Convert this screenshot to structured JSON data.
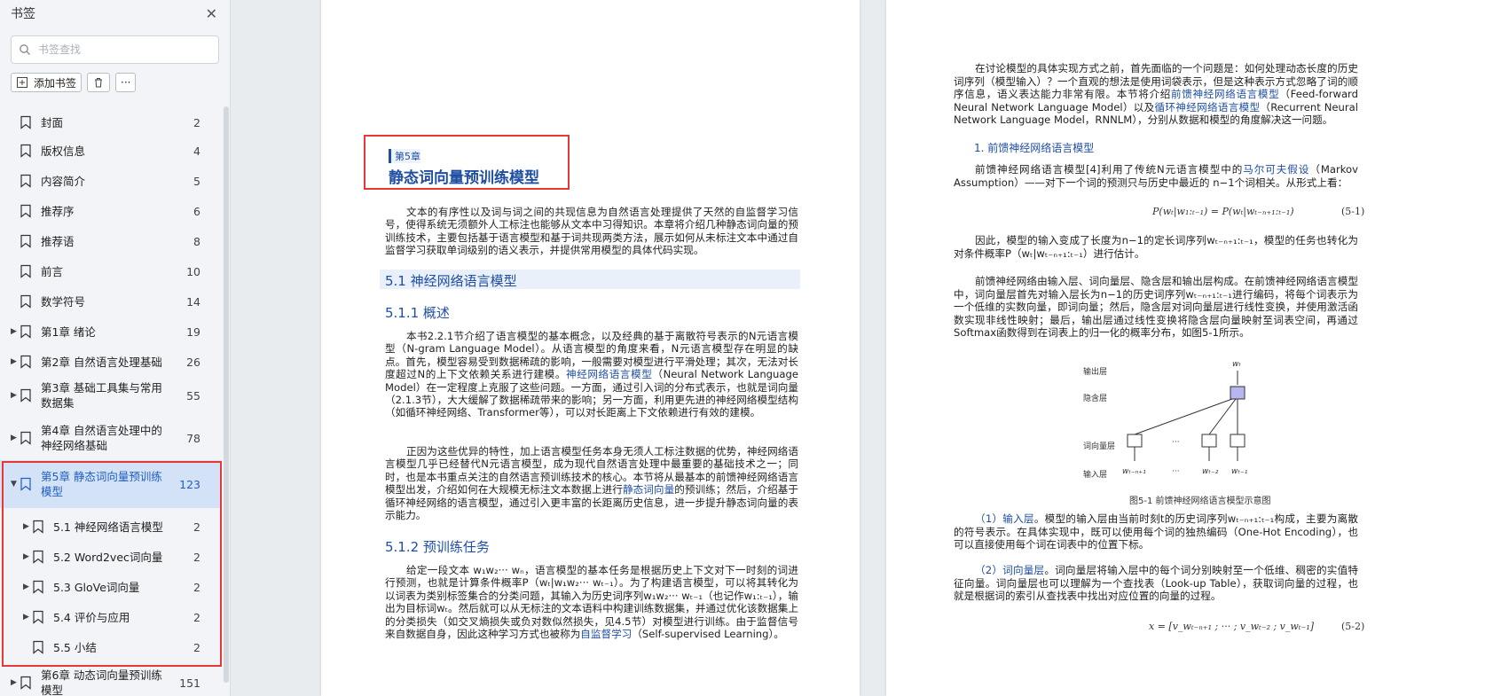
{
  "sidebar": {
    "title": "书签",
    "search_placeholder": "书签查找",
    "add_bookmark_label": "添加书签",
    "more_label": "···",
    "items": [
      {
        "title": "封面",
        "page": "2",
        "expandable": false,
        "level": 0
      },
      {
        "title": "版权信息",
        "page": "4",
        "expandable": false,
        "level": 0
      },
      {
        "title": "内容简介",
        "page": "5",
        "expandable": false,
        "level": 0
      },
      {
        "title": "推荐序",
        "page": "6",
        "expandable": false,
        "level": 0
      },
      {
        "title": "推荐语",
        "page": "8",
        "expandable": false,
        "level": 0
      },
      {
        "title": "前言",
        "page": "10",
        "expandable": false,
        "level": 0
      },
      {
        "title": "数学符号",
        "page": "14",
        "expandable": false,
        "level": 0
      },
      {
        "title": "第1章 绪论",
        "page": "19",
        "expandable": true,
        "level": 0
      },
      {
        "title": "第2章 自然语言处理基础",
        "page": "26",
        "expandable": true,
        "level": 0
      },
      {
        "title": "第3章 基础工具集与常用数据集",
        "page": "55",
        "expandable": true,
        "level": 0
      },
      {
        "title": "第4章 自然语言处理中的神经网络基础",
        "page": "78",
        "expandable": true,
        "level": 0
      },
      {
        "title": "第5章 静态词向量预训练模型",
        "page": "123",
        "expandable": true,
        "expanded": true,
        "selected": true,
        "level": 0
      },
      {
        "title": "5.1 神经网络语言模型",
        "page": "2",
        "expandable": true,
        "level": 1
      },
      {
        "title": "5.2 Word2vec词向量",
        "page": "2",
        "expandable": true,
        "level": 1
      },
      {
        "title": "5.3 GloVe词向量",
        "page": "2",
        "expandable": true,
        "level": 1
      },
      {
        "title": "5.4 评价与应用",
        "page": "2",
        "expandable": true,
        "level": 1
      },
      {
        "title": "5.5 小结",
        "page": "2",
        "expandable": false,
        "level": 1
      },
      {
        "title": "第6章 动态词向量预训练模型",
        "page": "151",
        "expandable": true,
        "level": 0
      }
    ]
  },
  "left_page": {
    "chapter_tag": "第5章",
    "chapter_title": "静态词向量预训练模型",
    "intro": "文本的有序性以及词与词之间的共现信息为自然语言处理提供了天然的自监督学习信号，使得系统无须额外人工标注也能够从文本中习得知识。本章将介绍几种静态词向量的预训练技术，主要包括基于语言模型和基于词共现两类方法，展示如何从未标注文本中通过自监督学习获取单词级别的语义表示，并提供常用模型的具体代码实现。",
    "h_5_1": "5.1  神经网络语言模型",
    "h_5_1_1": "5.1.1  概述",
    "p1_a": "本书2.2.1节介绍了语言模型的基本概念，以及经典的基于离散符号表示的N元语言模型（N-gram Language Model）。从语言模型的角度来看，N元语言模型存在明显的缺点。首先，模型容易受到数据稀疏的影响，一般需要对模型进行平滑处理；其次，无法对长度超过N的上下文依赖关系进行建模。",
    "p1_link": "神经网络语言模型",
    "p1_b": "（Neural Network Language Model）在一定程度上克服了这些问题。一方面，通过引入词的分布式表示，也就是词向量（2.1.3节），大大缓解了数据稀疏带来的影响；另一方面，利用更先进的神经网络模型结构（如循环神经网络、Transformer等），可以对长距离上下文依赖进行有效的建模。",
    "p2_a": "正因为这些优异的特性，加上语言模型任务本身无须人工标注数据的优势，神经网络语言模型几乎已经替代N元语言模型，成为现代自然语言处理中最重要的基础技术之一；同时，也是本书重点关注的自然语言预训练技术的核心。本节将从最基本的前馈神经网络语言模型出发，介绍如何在大规模无标注文本数据上进行",
    "p2_link": "静态词向量",
    "p2_b": "的预训练；然后，介绍基于循环神经网络的语言模型，通过引入更丰富的长距离历史信息，进一步提升静态词向量的表示能力。",
    "h_5_1_2": "5.1.2  预训练任务",
    "p3_a": "给定一段文本 w₁w₂··· wₙ，语言模型的基本任务是根据历史上下文对下一时刻的词进行预测，也就是计算条件概率P（wₜ|w₁w₂··· wₜ₋₁）。为了构建语言模型，可以将其转化为以词表为类别标签集合的分类问题，其输入为历史词序列w₁w₂··· wₜ₋₁（也记作w₁:ₜ₋₁），输出为目标词wₜ。然后就可以从无标注的文本语料中构建训练数据集，并通过优化该数据集上的分类损失（如交叉熵损失或负对数似然损失，见4.5节）对模型进行训练。由于监督信号来自数据自身，因此这种学习方式也被称为",
    "p3_link": "自监督学习",
    "p3_b": "（Self-supervised Learning）。"
  },
  "right_page": {
    "p1_a": "在讨论模型的具体实现方式之前，首先面临的一个问题是：如何处理动态长度的历史词序列（模型输入）？一个直观的想法是使用词袋表示，但是这种表示方式忽略了词的顺序信息，语义表达能力非常有限。本节将介绍",
    "p1_link1": "前馈神经网络语言模型",
    "p1_b": "（Feed-forward Neural Network Language Model）以及",
    "p1_link2": "循环神经网络语言模型",
    "p1_c": "（Recurrent Neural Network Language Model，RNNLM），分别从数据和模型的角度解决这一问题。",
    "sub1": "1. 前馈神经网络语言模型",
    "p2_a": "前馈神经网络语言模型[4]利用了传统N元语言模型中的",
    "p2_link": "马尔可夫假设",
    "p2_b": "（Markov Assumption）——对下一个词的预测只与历史中最近的 n−1个词相关。从形式上看：",
    "formula1": "P(wₜ|w₁:ₜ₋₁) = P(wₜ|wₜ₋ₙ₊₁:ₜ₋₁)",
    "eq1": "(5-1)",
    "p3": "因此，模型的输入变成了长度为n−1的定长词序列wₜ₋ₙ₊₁:ₜ₋₁，模型的任务也转化为对条件概率P（wₜ|wₜ₋ₙ₊₁:ₜ₋₁）进行估计。",
    "p4": "前馈神经网络由输入层、词向量层、隐含层和输出层构成。在前馈神经网络语言模型中，词向量层首先对输入层长为n−1的历史词序列wₜ₋ₙ₊₁:ₜ₋₁进行编码，将每个词表示为一个低维的实数向量，即词向量；然后，隐含层对词向量层进行线性变换，并使用激活函数实现非线性映射；最后，输出层通过线性变换将隐含层向量映射至词表空间，再通过Softmax函数得到在词表上的归一化的概率分布，如图5-1所示。",
    "fig": {
      "label_output": "输出层",
      "label_hidden": "隐含层",
      "label_embed": "词向量层",
      "label_input": "输入层",
      "out_word": "wₜ",
      "in1": "wₜ₋ₙ₊₁",
      "in2": "wₜ₋₂",
      "in3": "wₜ₋₁",
      "dots": "···",
      "caption": "图5-1  前馈神经网络语言模型示意图"
    },
    "p5_link": "（1）输入层",
    "p5_b": "。模型的输入层由当前时刻t的历史词序列wₜ₋ₙ₊₁:ₜ₋₁构成，主要为离散的符号表示。在具体实现中，既可以使用每个词的独热编码（One-Hot Encoding），也可以直接使用每个词在词表中的位置下标。",
    "p6_link": "（2）词向量层",
    "p6_b": "。词向量层将输入层中的每个词分别映射至一个低维、稠密的实值特征向量。词向量层也可以理解为一个查找表（Look-up Table），获取词向量的过程，也就是根据词的索引从查找表中找出对应位置的向量的过程。",
    "formula2": "x = [v_wₜ₋ₙ₊₁ ; ··· ; v_wₜ₋₂ ; v_wₜ₋₁]",
    "eq2": "(5-2)"
  },
  "colors": {
    "accent": "#1f4ea3",
    "highlight_box": "#e53935",
    "selected_bg": "#d4e2f7"
  }
}
